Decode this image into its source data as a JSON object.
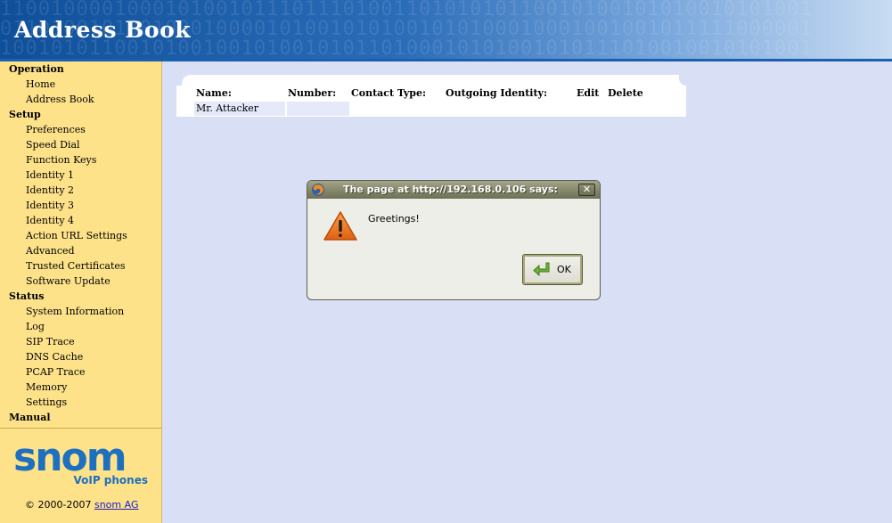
{
  "header": {
    "title": "Address Book",
    "binary_rows": [
      "1100100001000101001011101110100110101010110010100101010010101001",
      "0110100101001000100001010010101001010100010001001001011111000001",
      "1001010110010100100101001010110100010101001010111010010010101001"
    ]
  },
  "nav": {
    "sections": [
      {
        "label": "Operation",
        "items": [
          "Home",
          "Address Book"
        ]
      },
      {
        "label": "Setup",
        "items": [
          "Preferences",
          "Speed Dial",
          "Function Keys",
          "Identity 1",
          "Identity 2",
          "Identity 3",
          "Identity 4",
          "Action URL Settings",
          "Advanced",
          "Trusted Certificates",
          "Software Update"
        ]
      },
      {
        "label": "Status",
        "items": [
          "System Information",
          "Log",
          "SIP Trace",
          "DNS Cache",
          "PCAP Trace",
          "Memory",
          "Settings"
        ]
      },
      {
        "label": "Manual",
        "items": []
      }
    ]
  },
  "logo": {
    "word": "snom",
    "sub": "VoIP phones"
  },
  "copyright": {
    "text": "© 2000-2007",
    "link": "snom AG"
  },
  "table": {
    "headers": [
      "Name:",
      "Number:",
      "Contact Type:",
      "Outgoing Identity:",
      "Edit",
      "Delete"
    ],
    "rows": [
      {
        "name": "Mr. Attacker",
        "number": ""
      }
    ]
  },
  "dialog": {
    "title": "The page at http://192.168.0.106 says:",
    "message": "Greetings!",
    "ok_label": "OK",
    "close_glyph": "✕"
  },
  "colors": {
    "page_bg": "#d9dff5",
    "sidebar_bg": "#fde28a",
    "header_blue": "#0f4f9a",
    "snom_blue": "#1d6fbf",
    "row_highlight": "#e5e9fa"
  }
}
